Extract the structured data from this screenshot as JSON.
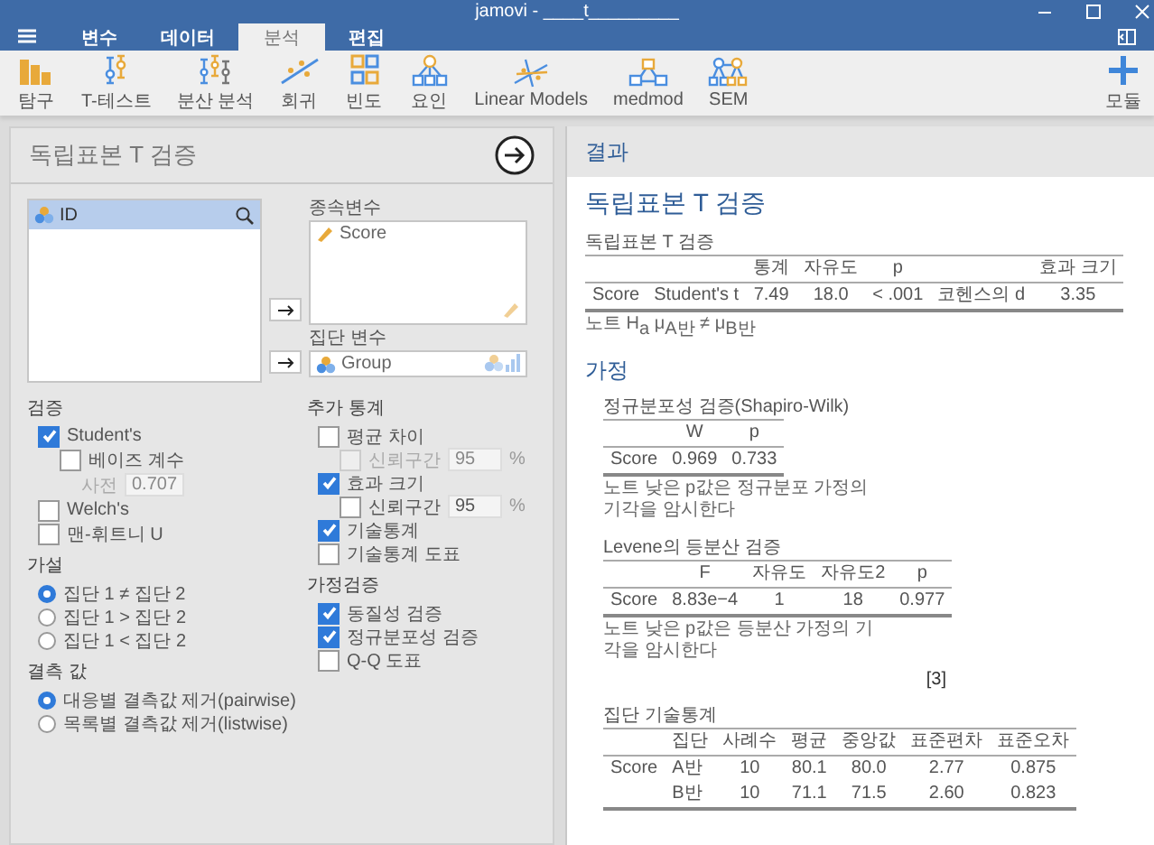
{
  "window": {
    "title": "jamovi - ____t_________"
  },
  "tabs": [
    {
      "label": "변수",
      "selected": false
    },
    {
      "label": "데이터",
      "selected": false
    },
    {
      "label": "분석",
      "selected": true
    },
    {
      "label": "편집",
      "selected": false
    }
  ],
  "ribbon": [
    {
      "label": "탐구",
      "kind": "bars"
    },
    {
      "label": "T-테스트",
      "kind": "ttest"
    },
    {
      "label": "분산 분석",
      "kind": "anova"
    },
    {
      "label": "회귀",
      "kind": "regression"
    },
    {
      "label": "빈도",
      "kind": "grid"
    },
    {
      "label": "요인",
      "kind": "tree"
    },
    {
      "label": "Linear Models",
      "kind": "linear"
    },
    {
      "label": "medmod",
      "kind": "medmod"
    },
    {
      "label": "SEM",
      "kind": "sem"
    }
  ],
  "modules": {
    "label": "모듈"
  },
  "analysis": {
    "title": "독립표본 T 검증",
    "variables": [
      {
        "name": "ID",
        "kind": "nominal",
        "selected": true
      }
    ],
    "targets": [
      {
        "label": "종속변수",
        "kind": "continuous",
        "items": [
          {
            "name": "Score",
            "kind": "continuous"
          }
        ]
      },
      {
        "label": "집단 변수",
        "kind": "nominal",
        "items": [
          {
            "name": "Group",
            "kind": "nominal"
          }
        ]
      }
    ],
    "columns": [
      [
        {
          "heading": "검증",
          "options": [
            {
              "kind": "checkbox",
              "label": "Student's",
              "checked": true,
              "children": [
                {
                  "kind": "checkbox",
                  "label": "베이즈 계수",
                  "checked": false,
                  "children": [
                    {
                      "kind": "field",
                      "label": "사전",
                      "value": "0.707",
                      "disabled": true
                    }
                  ]
                }
              ]
            },
            {
              "kind": "checkbox",
              "label": "Welch's",
              "checked": false
            },
            {
              "kind": "checkbox",
              "label": "맨-휘트니 U",
              "checked": false
            }
          ]
        },
        {
          "heading": "가설",
          "options": [
            {
              "kind": "radio",
              "label": "집단 1 ≠ 집단 2",
              "selected": true
            },
            {
              "kind": "radio",
              "label": "집단 1 > 집단 2",
              "selected": false
            },
            {
              "kind": "radio",
              "label": "집단 1 < 집단 2",
              "selected": false
            }
          ]
        },
        {
          "heading": "결측 값",
          "options": [
            {
              "kind": "radio",
              "label": "대응별 결측값 제거(pairwise)",
              "selected": true
            },
            {
              "kind": "radio",
              "label": "목록별 결측값 제거(listwise)",
              "selected": false
            }
          ]
        }
      ],
      [
        {
          "heading": "추가 통계",
          "options": [
            {
              "kind": "checkbox",
              "label": "평균 차이",
              "checked": false,
              "children": [
                {
                  "kind": "checkbox",
                  "label": "신뢰구간",
                  "checked": false,
                  "disabled": true,
                  "value": "95",
                  "unit": "%"
                }
              ]
            },
            {
              "kind": "checkbox",
              "label": "효과 크기",
              "checked": true,
              "children": [
                {
                  "kind": "checkbox",
                  "label": "신뢰구간",
                  "checked": false,
                  "disabled": false,
                  "value": "95",
                  "unit": "%"
                }
              ]
            },
            {
              "kind": "checkbox",
              "label": "기술통계",
              "checked": true
            },
            {
              "kind": "checkbox",
              "label": "기술통계 도표",
              "checked": false
            }
          ]
        },
        {
          "heading": "가정검증",
          "options": [
            {
              "kind": "checkbox",
              "label": "동질성 검증",
              "checked": true
            },
            {
              "kind": "checkbox",
              "label": "정규분포성 검증",
              "checked": true
            },
            {
              "kind": "checkbox",
              "label": "Q-Q 도표",
              "checked": false
            }
          ]
        }
      ]
    ]
  },
  "results": {
    "header": "결과",
    "items": [
      {
        "kind": "title",
        "text": "독립표본 T 검증"
      },
      {
        "kind": "table",
        "caption": "독립표본 T 검증",
        "columns": [
          null,
          null,
          "통계",
          "자유도",
          "p",
          null,
          "효과 크기"
        ],
        "rows": [
          [
            "Score",
            "Student's t",
            "7.49",
            "18.0",
            "< .001",
            "코헨스의 d",
            "3.35"
          ]
        ],
        "note": "노트 H$_{a}$ μ$_{A반}$ ≠ μ$_{B반}$"
      },
      {
        "kind": "heading",
        "text": "가정"
      },
      {
        "kind": "table",
        "caption": "정규분포성 검증(Shapiro-Wilk)",
        "columns": [
          null,
          "W",
          "p"
        ],
        "rows": [
          [
            "Score",
            "0.969",
            "0.733"
          ]
        ],
        "note": "노트 낮은 p값은 정규분포 가정의 기각을 암시한다"
      },
      {
        "kind": "table",
        "caption": "Levene의 등분산 검증",
        "columns": [
          null,
          "F",
          "자유도",
          "자유도2",
          "p"
        ],
        "rows": [
          [
            "Score",
            "8.83e−4",
            "1",
            "18",
            "0.977"
          ]
        ],
        "note": "노트 낮은 p값은 등분산 가정의 기각을 암시한다"
      },
      {
        "kind": "reference",
        "text": "[3]"
      },
      {
        "kind": "table",
        "caption": "집단 기술통계",
        "columns": [
          null,
          "집단",
          "사례수",
          "평균",
          "중앙값",
          "표준편차",
          "표준오차"
        ],
        "rows": [
          [
            "Score",
            "A반",
            "10",
            "80.1",
            "80.0",
            "2.77",
            "0.875"
          ],
          [
            null,
            "B반",
            "10",
            "71.1",
            "71.5",
            "2.60",
            "0.823"
          ]
        ]
      }
    ]
  }
}
